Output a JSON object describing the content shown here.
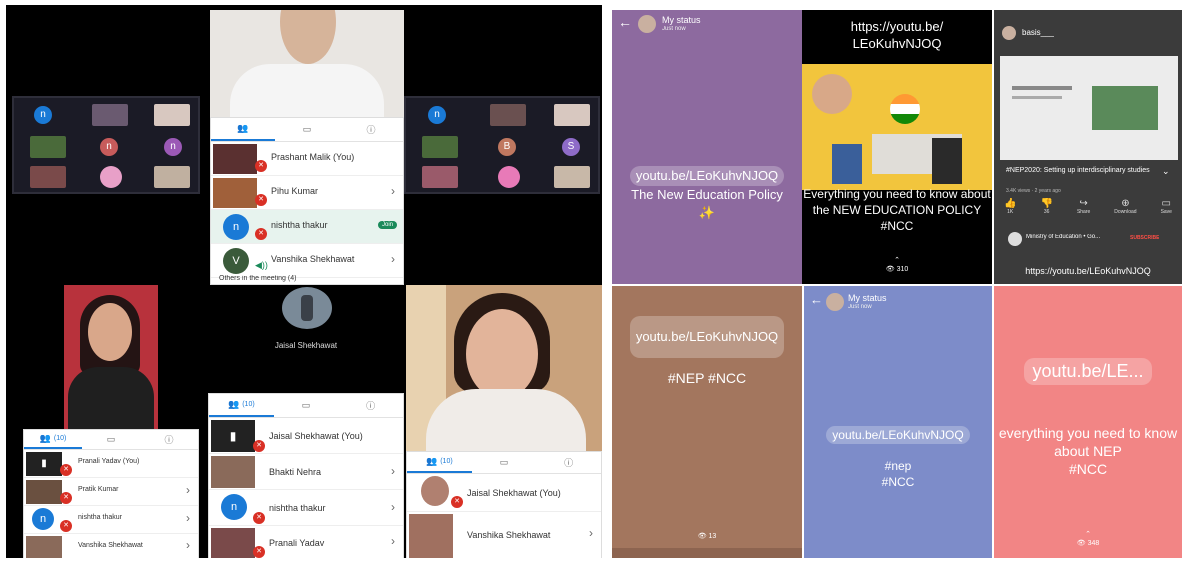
{
  "meet": {
    "colors": {
      "background": "#000000",
      "accent": "#1a7ad6",
      "badge": "#d93025"
    },
    "tiles_left": [
      "n",
      "n",
      "n"
    ],
    "tiles_right": [
      "n",
      "B",
      "S"
    ],
    "panel_top": {
      "participants": [
        {
          "name": "Prashant Malik (You)"
        },
        {
          "name": "Pihu Kumar"
        },
        {
          "name": "nishtha thakur",
          "pill": "Join"
        },
        {
          "name": "Vanshika Shekhawat"
        }
      ],
      "footer": "Others in the meeting (4)"
    },
    "center_name": "Jaisal Shekhawat",
    "panel_center": {
      "tab_count": "(10)",
      "participants": [
        {
          "name": "Jaisal Shekhawat (You)"
        },
        {
          "name": "Bhakti Nehra"
        },
        {
          "name": "nishtha thakur"
        },
        {
          "name": "Pranali Yadav"
        }
      ]
    },
    "panel_left": {
      "tab_count": "(10)",
      "participants": [
        {
          "name": "Pranali Yadav (You)"
        },
        {
          "name": "Pratik Kumar"
        },
        {
          "name": "nishtha thakur"
        },
        {
          "name": "Vanshika Shekhawat"
        }
      ]
    },
    "panel_right": {
      "tab_count": "(10)",
      "participants": [
        {
          "name": "Jaisal Shekhawat (You)"
        },
        {
          "name": "Vanshika Shekhawat"
        }
      ]
    }
  },
  "statuses": {
    "s1": {
      "header": "My status",
      "sub": "Just now",
      "link": "youtu.be/LEoKuhvNJOQ",
      "text": "The New Education Policy",
      "sparkle": "✨",
      "color": "#8d6a9f"
    },
    "s2": {
      "url": "https://youtu.be/\nLEoKuhvNJOQ",
      "caption": "Everything you need to know about the NEW EDUCATION POLICY\n#NCC",
      "views": "⌃\n👁 310",
      "color": "#000000",
      "banner": "#f2c53d"
    },
    "s3": {
      "header": "basis___",
      "video_title": "#NEP2020: Setting up interdisciplinary studies",
      "meta": "3.4K views · 2 years ago",
      "actions": [
        {
          "icon": "like-icon",
          "label": "1K"
        },
        {
          "icon": "dislike-icon",
          "label": "36"
        },
        {
          "icon": "share-icon",
          "label": "Share"
        },
        {
          "icon": "download-icon",
          "label": "Download"
        },
        {
          "icon": "save-icon",
          "label": "Save"
        }
      ],
      "channel": "Ministry of Education • Go...",
      "subscribe": "SUBSCRIBE",
      "url": "https://youtu.be/LEoKuhvNJOQ",
      "color": "#3b3b3b"
    },
    "s4": {
      "link": "youtu.be/LEoKuhvNJOQ",
      "tags": "#NEP #NCC",
      "views": "👁 13",
      "color": "#a3765e"
    },
    "s5": {
      "header": "My status",
      "sub": "Just now",
      "link": "youtu.be/LEoKuhvNJOQ",
      "tags": "#nep\n#NCC",
      "color": "#7d8cc9"
    },
    "s6": {
      "link": "youtu.be/LE...",
      "caption": "everything you need to know about NEP\n#NCC",
      "views": "⌃\n👁 348",
      "color": "#f28585"
    }
  }
}
